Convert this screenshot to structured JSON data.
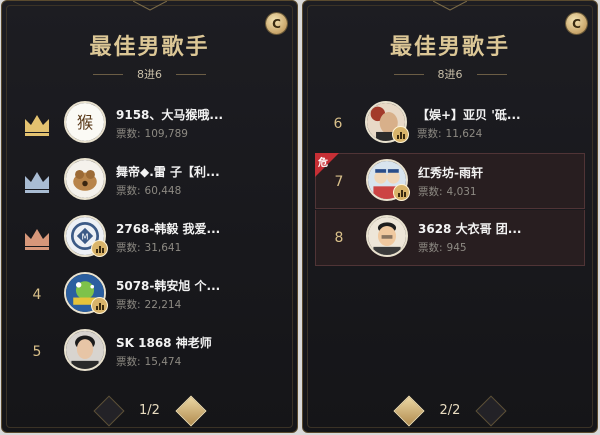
{
  "panels": [
    {
      "title": "最佳男歌手",
      "subtitle": "8进6",
      "corner_label": "C",
      "pager": "1/2",
      "entries": [
        {
          "rank": "",
          "crown": "gold",
          "name": "9158、大马猴哦...",
          "vote_label": "票数:",
          "votes": "109,789",
          "live": false,
          "danger": false
        },
        {
          "rank": "",
          "crown": "silver",
          "name": "舞帝◆.雷 子【利...",
          "vote_label": "票数:",
          "votes": "60,448",
          "live": false,
          "danger": false
        },
        {
          "rank": "",
          "crown": "bronze",
          "name": "2768-韩毅 我爱...",
          "vote_label": "票数:",
          "votes": "31,641",
          "live": true,
          "danger": false
        },
        {
          "rank": "4",
          "crown": "",
          "name": "5078-韩安旭 个...",
          "vote_label": "票数:",
          "votes": "22,214",
          "live": true,
          "danger": false
        },
        {
          "rank": "5",
          "crown": "",
          "name": "SK 1868 神老师",
          "vote_label": "票数:",
          "votes": "15,474",
          "live": false,
          "danger": false
        }
      ]
    },
    {
      "title": "最佳男歌手",
      "subtitle": "8进6",
      "corner_label": "C",
      "pager": "2/2",
      "entries": [
        {
          "rank": "6",
          "crown": "",
          "name": "【娱+】亚贝 '砥...",
          "vote_label": "票数:",
          "votes": "11,624",
          "live": true,
          "danger": false
        },
        {
          "rank": "7",
          "crown": "",
          "name": "红秀坊-雨轩",
          "vote_label": "票数:",
          "votes": "4,031",
          "live": true,
          "danger": true,
          "danger_label": "危"
        },
        {
          "rank": "8",
          "crown": "",
          "name": "3628 大衣哥 团...",
          "vote_label": "票数:",
          "votes": "945",
          "live": false,
          "danger": true
        }
      ]
    }
  ],
  "colors": {
    "gold_crown": "#e3c270",
    "silver_crown": "#a9bcd3",
    "bronze_crown": "#d7977a",
    "title": "#dcc796",
    "danger": "#c62f35"
  },
  "icons": {
    "crown": "crown-icon",
    "live": "bar-chart-icon",
    "corner": "c-coin-icon",
    "prev": "chevron-left-icon",
    "next": "chevron-right-icon"
  }
}
